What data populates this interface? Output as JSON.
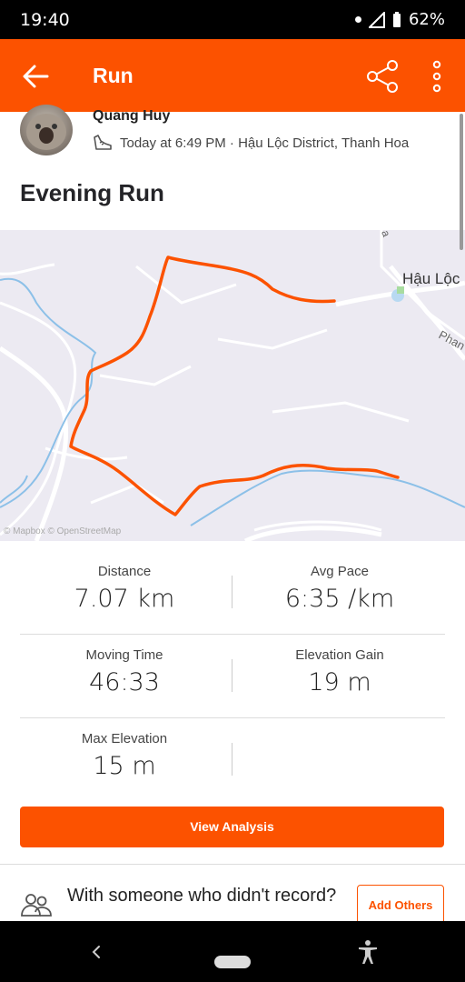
{
  "status_bar": {
    "time": "19:40",
    "battery": "62%"
  },
  "app_bar": {
    "title": "Run"
  },
  "activity": {
    "user_name": "Quang Huy",
    "meta": "Today at 6:49 PM · Hậu Lộc District, Thanh Hoa",
    "title": "Evening Run"
  },
  "map": {
    "place_label": "Hậu Lộc",
    "road_label": "Phan",
    "road_label_2": "a",
    "attribution": "© Mapbox © OpenStreetMap",
    "route_color": "#fc5200"
  },
  "stats": [
    {
      "label": "Distance",
      "value": "7.07 km"
    },
    {
      "label": "Avg Pace",
      "value": "6:35 /km"
    },
    {
      "label": "Moving Time",
      "value": "46:33"
    },
    {
      "label": "Elevation Gain",
      "value": "19 m"
    },
    {
      "label": "Max Elevation",
      "value": "15 m"
    }
  ],
  "analysis_button": "View Analysis",
  "with_someone": {
    "text": "With someone who didn't record?",
    "button": "Add Others"
  },
  "colors": {
    "accent": "#fc5200"
  }
}
